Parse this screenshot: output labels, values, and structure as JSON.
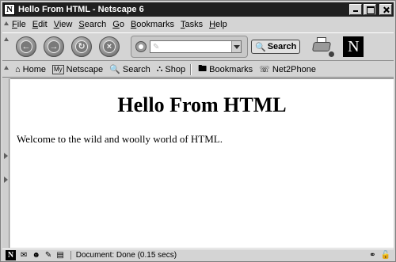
{
  "window": {
    "title": "Hello From HTML - Netscape 6"
  },
  "menubar": {
    "items": [
      {
        "pre": "",
        "u": "F",
        "post": "ile"
      },
      {
        "pre": "",
        "u": "E",
        "post": "dit"
      },
      {
        "pre": "",
        "u": "V",
        "post": "iew"
      },
      {
        "pre": "",
        "u": "S",
        "post": "earch"
      },
      {
        "pre": "",
        "u": "G",
        "post": "o"
      },
      {
        "pre": "",
        "u": "B",
        "post": "ookmarks"
      },
      {
        "pre": "",
        "u": "T",
        "post": "asks"
      },
      {
        "pre": "",
        "u": "H",
        "post": "elp"
      }
    ]
  },
  "navbar": {
    "back_icon": "back-arrow-icon",
    "forward_icon": "forward-arrow-icon",
    "reload_icon": "reload-icon",
    "stop_icon": "stop-icon",
    "url_value": "",
    "search_label": "Search"
  },
  "personalbar": {
    "home": "Home",
    "my_icon": "My",
    "netscape": "Netscape",
    "search": "Search",
    "shop": "Shop",
    "bookmarks": "Bookmarks",
    "net2phone": "Net2Phone"
  },
  "content": {
    "heading": "Hello From HTML",
    "paragraph": "Welcome to the wild and woolly world of HTML."
  },
  "statusbar": {
    "text": "Document: Done (0.15 secs)"
  },
  "logo": {
    "letter": "N"
  }
}
